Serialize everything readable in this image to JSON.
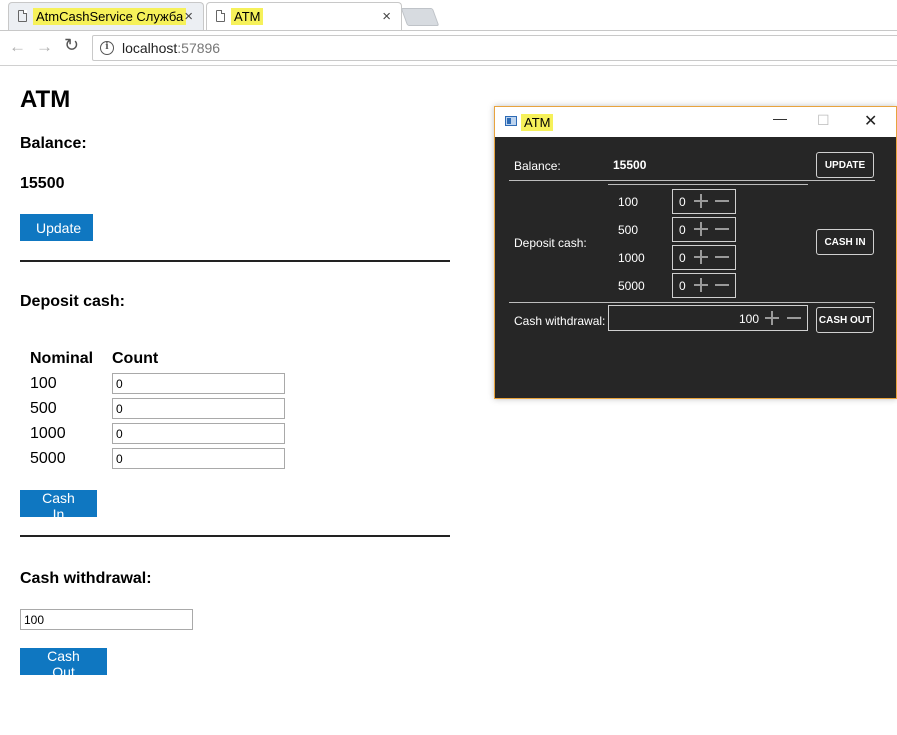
{
  "browser": {
    "tabs": [
      {
        "title": "AtmCashService Служба",
        "close": "×"
      },
      {
        "title": "ATM",
        "close": "×"
      }
    ],
    "url_host": "localhost",
    "url_port": ":57896",
    "info_glyph": "i",
    "back_glyph": "←",
    "forward_glyph": "→",
    "reload_glyph": "↻"
  },
  "web": {
    "title": "ATM",
    "balance_heading": "Balance:",
    "balance_value": "15500",
    "update_label": "Update",
    "deposit_heading": "Deposit cash:",
    "table_headers": {
      "nominal": "Nominal",
      "count": "Count"
    },
    "deposit_rows": [
      {
        "nominal": "100",
        "count": "0"
      },
      {
        "nominal": "500",
        "count": "0"
      },
      {
        "nominal": "1000",
        "count": "0"
      },
      {
        "nominal": "5000",
        "count": "0"
      }
    ],
    "cashin_label": "Cash In",
    "withdraw_heading": "Cash withdrawal:",
    "withdraw_value": "100",
    "cashout_label": "Cash Out",
    "button_color": "#0f77c1"
  },
  "desktop": {
    "title": "ATM",
    "controls": {
      "minimize": "—",
      "maximize": "☐",
      "close": "✕"
    },
    "balance_label": "Balance:",
    "balance_value": "15500",
    "update_label": "UPDATE",
    "deposit_label": "Deposit cash:",
    "deposit_rows": [
      {
        "nominal": "100",
        "count": "0"
      },
      {
        "nominal": "500",
        "count": "0"
      },
      {
        "nominal": "1000",
        "count": "0"
      },
      {
        "nominal": "5000",
        "count": "0"
      }
    ],
    "cashin_label": "CASH IN",
    "withdraw_label": "Cash withdrawal:",
    "withdraw_value": "100",
    "cashout_label": "CASH OUT",
    "background_color": "#262626",
    "border_color": "#e8a33d"
  },
  "highlight_color": "#f6f15a"
}
